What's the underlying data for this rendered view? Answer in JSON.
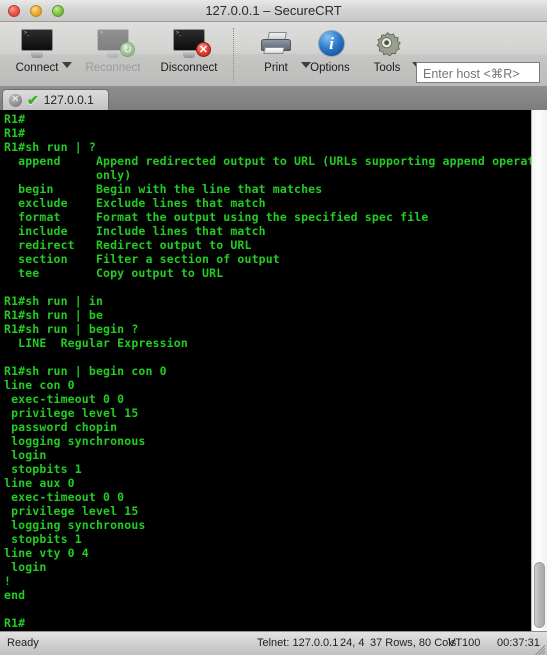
{
  "window": {
    "title": "127.0.0.1 – SecureCRT",
    "traffic_lights": [
      "close-button",
      "minimize-button",
      "zoom-button"
    ]
  },
  "toolbar": {
    "items": [
      {
        "label": "Connect",
        "icon": "monitor-icon",
        "has_caret": true,
        "disabled": false
      },
      {
        "label": "Reconnect",
        "icon": "monitor-refresh-icon",
        "has_caret": false,
        "disabled": true
      },
      {
        "label": "Disconnect",
        "icon": "monitor-disconnect-icon",
        "has_caret": false,
        "disabled": false
      },
      {
        "label": "Print",
        "icon": "printer-icon",
        "has_caret": true,
        "disabled": false
      },
      {
        "label": "Options",
        "icon": "info-icon",
        "has_caret": false,
        "disabled": false
      },
      {
        "label": "Tools",
        "icon": "gear-icon",
        "has_caret": true,
        "disabled": false
      }
    ],
    "host_field": {
      "placeholder": "Enter host <⌘R>",
      "value": ""
    }
  },
  "tabs": [
    {
      "label": "127.0.0.1",
      "close_glyph": "✕",
      "status_glyph": "✔",
      "status_color": "#3fae2a",
      "active": true
    }
  ],
  "terminal": {
    "foreground": "#22cc22",
    "background": "#000000",
    "rows": 37,
    "cols": 80,
    "content": "R1#\nR1#\nR1#sh run | ?\n  append     Append redirected output to URL (URLs supporting append operation\n             only)\n  begin      Begin with the line that matches\n  exclude    Exclude lines that match\n  format     Format the output using the specified spec file\n  include    Include lines that match\n  redirect   Redirect output to URL\n  section    Filter a section of output\n  tee        Copy output to URL\n\nR1#sh run | in\nR1#sh run | be\nR1#sh run | begin ?\n  LINE  Regular Expression\n\nR1#sh run | begin con 0\nline con 0\n exec-timeout 0 0\n privilege level 15\n password chopin\n logging synchronous\n login\n stopbits 1\nline aux 0\n exec-timeout 0 0\n privilege level 15\n logging synchronous\n stopbits 1\nline vty 0 4\n login\n!\nend\n\nR1#"
  },
  "scrollbar": {
    "orientation": "vertical",
    "thumb_position_pct": 87
  },
  "statusbar": {
    "ready": "Ready",
    "connection": "Telnet: 127.0.0.1",
    "cursor": "24, 4",
    "dimensions": "37 Rows, 80 Cols",
    "emulation": "VT100",
    "elapsed": "00:37:31"
  }
}
